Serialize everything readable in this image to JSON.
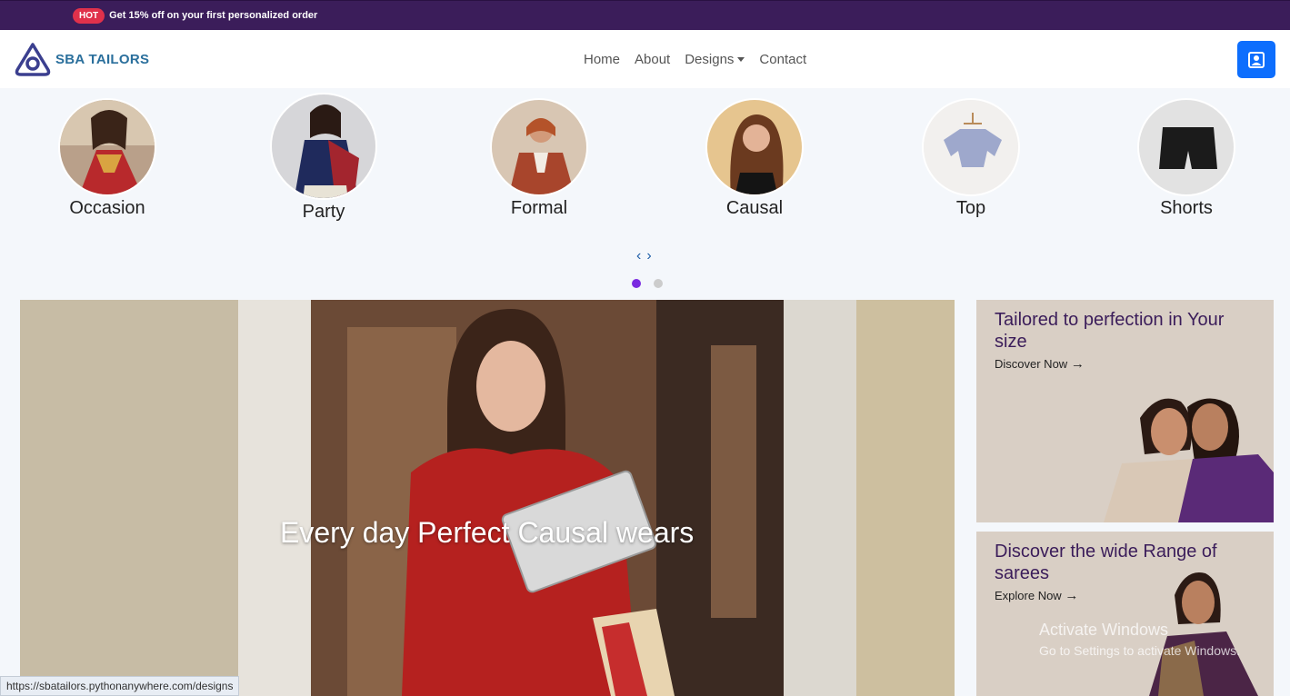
{
  "topbar": {
    "badge": "HOT",
    "promo_text": "Get 15% off on your first personalized order"
  },
  "brand": {
    "name": "SBA TAILORS"
  },
  "nav": {
    "home": "Home",
    "about": "About",
    "designs": "Designs",
    "contact": "Contact"
  },
  "categories": [
    {
      "label": "Occasion"
    },
    {
      "label": "Party"
    },
    {
      "label": "Formal"
    },
    {
      "label": "Causal"
    },
    {
      "label": "Top"
    },
    {
      "label": "Shorts"
    }
  ],
  "carousel": {
    "prev": "‹",
    "next": "›"
  },
  "hero": {
    "caption": "Every day Perfect Causal wears"
  },
  "promo_cards": [
    {
      "title": "Tailored to perfection in Your size",
      "link": "Discover Now"
    },
    {
      "title": "Discover the wide Range of sarees",
      "link": "Explore Now"
    }
  ],
  "status_bar": {
    "url": "https://sbatailors.pythonanywhere.com/designs"
  },
  "watermark": {
    "line1": "Activate Windows",
    "line2": "Go to Settings to activate Windows."
  },
  "colors": {
    "topbar": "#3b1d5a",
    "accent": "#0d6efd",
    "badge": "#e0314b",
    "dot_active": "#7a2ae0"
  }
}
